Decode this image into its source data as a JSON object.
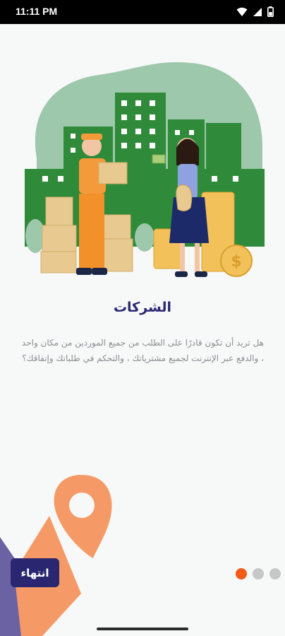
{
  "status_bar": {
    "time": "11:11 PM",
    "icons": [
      "wifi-icon",
      "signal-icon",
      "battery-icon"
    ]
  },
  "onboarding": {
    "illustration": "delivery-and-customer-illustration",
    "title": "الشركات",
    "description": "هل تريد أن تكون قادرًا على الطلب من جميع الموردين من مكان واحد ، والدفع عبر الإنترنت لجميع مشترياتك ، والتحكم في طلباتك وإنفاقك؟",
    "finish_label": "انتهاء",
    "pager": {
      "total": 3,
      "current": 1
    }
  },
  "colors": {
    "primary": "#2a2770",
    "accent": "#f25a16",
    "deco_orange": "#f59a67",
    "deco_purple": "#6a62a3",
    "hero_green": "#2f8a3a",
    "hero_mint": "#9ec8ab"
  }
}
